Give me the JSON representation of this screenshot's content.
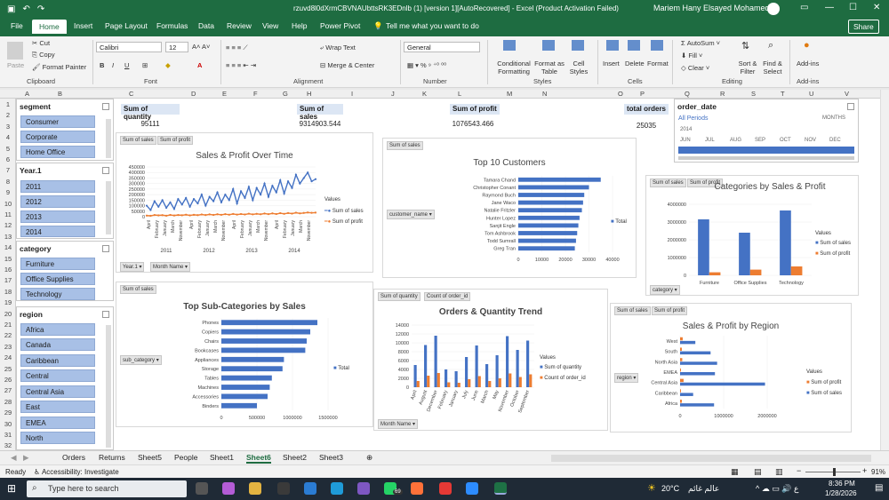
{
  "window": {
    "title": "rzuvd8l0dXrmCBVNAUbttsRK3EDnlb (1) [version 1][AutoRecovered] - Excel (Product Activation Failed)",
    "user": "Mariem Hany Elsayed Mohamed"
  },
  "menu": {
    "tabs": [
      "File",
      "Home",
      "Insert",
      "Page Layout",
      "Formulas",
      "Data",
      "Review",
      "View",
      "Help",
      "Power Pivot"
    ],
    "tell": "Tell me what you want to do",
    "share": "Share"
  },
  "ribbon": {
    "clipboard": {
      "paste": "Paste",
      "cut": "Cut",
      "copy": "Copy",
      "painter": "Format Painter",
      "group": "Clipboard"
    },
    "font": {
      "name": "Calibri",
      "size": "12",
      "group": "Font"
    },
    "alignment": {
      "wrap": "Wrap Text",
      "merge": "Merge & Center",
      "group": "Alignment"
    },
    "number": {
      "format": "General",
      "group": "Number"
    },
    "styles": {
      "cond": "Conditional Formatting",
      "table": "Format as Table",
      "cell": "Cell Styles",
      "group": "Styles"
    },
    "cells": {
      "insert": "Insert",
      "delete": "Delete",
      "format": "Format",
      "group": "Cells"
    },
    "editing": {
      "autosum": "AutoSum",
      "fill": "Fill",
      "clear": "Clear",
      "sort": "Sort & Filter",
      "find": "Find & Select",
      "group": "Editing"
    },
    "addins": {
      "label": "Add-ins",
      "group": "Add-ins"
    }
  },
  "columns": [
    "A",
    "B",
    "C",
    "D",
    "E",
    "F",
    "G",
    "H",
    "I",
    "J",
    "K",
    "L",
    "M",
    "N",
    "O",
    "P",
    "Q",
    "R",
    "S",
    "T",
    "U",
    "V",
    "W"
  ],
  "rows": [
    "1",
    "2",
    "3",
    "4",
    "5",
    "6",
    "7",
    "8",
    "9",
    "10",
    "11",
    "12",
    "13",
    "14",
    "15",
    "16",
    "17",
    "18",
    "19",
    "20",
    "21",
    "22",
    "23",
    "24",
    "25",
    "26",
    "27",
    "28",
    "29",
    "30",
    "31",
    "32"
  ],
  "slicers": {
    "segment": {
      "title": "segment",
      "items": [
        "Consumer",
        "Corporate",
        "Home Office"
      ]
    },
    "year": {
      "title": "Year.1",
      "items": [
        "2011",
        "2012",
        "2013",
        "2014"
      ]
    },
    "category": {
      "title": "category",
      "items": [
        "Furniture",
        "Office Supplies",
        "Technology"
      ]
    },
    "region": {
      "title": "region",
      "items": [
        "Africa",
        "Canada",
        "Caribbean",
        "Central",
        "Central Asia",
        "East",
        "EMEA",
        "North"
      ]
    },
    "order_date": {
      "title": "order_date",
      "period": "All Periods",
      "unit": "MONTHS",
      "year": "2014",
      "months": [
        "JUN",
        "JUL",
        "AUG",
        "SEP",
        "OCT",
        "NOV",
        "DEC"
      ]
    }
  },
  "kpis": [
    {
      "label": "Sum of quantity",
      "value": "95111"
    },
    {
      "label": "Sum of sales",
      "value": "9314903.544"
    },
    {
      "label": "Sum of profit",
      "value": "1076543.466"
    },
    {
      "label": "total orders",
      "value": "25035"
    }
  ],
  "chart_data": [
    {
      "type": "line",
      "title": "Sales & Profit Over Time",
      "yticks": [
        "450000",
        "400000",
        "350000",
        "300000",
        "250000",
        "200000",
        "150000",
        "100000",
        "50000",
        "0"
      ],
      "years": [
        "2011",
        "2012",
        "2013",
        "2014"
      ],
      "months": [
        "April",
        "February",
        "January",
        "March",
        "November"
      ],
      "series": [
        {
          "name": "Sum of sales",
          "color": "#4472c4",
          "values": [
            100000,
            60000,
            140000,
            90000,
            150000,
            80000,
            130000,
            70000,
            160000,
            110000,
            170000,
            90000,
            160000,
            120000,
            200000,
            100000,
            180000,
            140000,
            220000,
            130000,
            200000,
            150000,
            250000,
            120000,
            230000,
            170000,
            270000,
            150000,
            260000,
            200000,
            300000,
            180000,
            280000,
            220000,
            330000,
            210000,
            320000,
            260000,
            380000,
            300000,
            350000,
            400000,
            320000,
            340000
          ]
        },
        {
          "name": "Sum of profit",
          "color": "#ed7d31",
          "values": [
            10000,
            8000,
            15000,
            12000,
            14000,
            9000,
            16000,
            11000,
            15000,
            13000,
            18000,
            12000,
            17000,
            14000,
            20000,
            15000,
            21000,
            16000,
            22000,
            17000,
            23000,
            18000,
            25000,
            19000,
            24000,
            20000,
            27000,
            21000,
            26000,
            22000,
            29000,
            23000,
            30000,
            24000,
            32000,
            26000,
            33000,
            28000,
            36000,
            30000,
            34000,
            38000,
            35000,
            37000
          ]
        }
      ],
      "legend_title": "Values",
      "buttons": [
        "Sum of sales",
        "Sum of profit",
        "Year.1",
        "Month Name"
      ]
    },
    {
      "type": "bar",
      "title": "Top 10 Customers",
      "categories": [
        "Tamara Chand",
        "Christopher Conant",
        "Raymond Buch",
        "Jane Waco",
        "Natalie Fritzler",
        "Hunter Lopez",
        "Sanjit Engle",
        "Tom Ashbrook",
        "Todd Sumrall",
        "Greg Tran"
      ],
      "values": [
        35000,
        30000,
        28000,
        27500,
        27000,
        26000,
        25500,
        25000,
        24500,
        24000
      ],
      "xticks": [
        "0",
        "10000",
        "20000",
        "30000",
        "40000"
      ],
      "xlim": [
        0,
        40000
      ],
      "legend": "Total",
      "buttons": [
        "Sum of sales",
        "customer_name"
      ]
    },
    {
      "type": "bar",
      "title": "Categories by Sales & Profit",
      "categories": [
        "Furniture",
        "Office Supplies",
        "Technology"
      ],
      "yticks": [
        "4000000",
        "3000000",
        "2000000",
        "1000000",
        "0"
      ],
      "ylim": [
        0,
        4000000
      ],
      "series": [
        {
          "name": "Sum of sales",
          "color": "#4472c4",
          "values": [
            3150000,
            2400000,
            3650000
          ]
        },
        {
          "name": "Sum of profit",
          "color": "#ed7d31",
          "values": [
            170000,
            320000,
            500000
          ]
        }
      ],
      "legend_title": "Values",
      "buttons": [
        "Sum of sales",
        "Sum of profit",
        "category"
      ]
    },
    {
      "type": "bar",
      "title": "Top Sub-Categories by Sales",
      "categories": [
        "Phones",
        "Copiers",
        "Chairs",
        "Bookcases",
        "Appliances",
        "Storage",
        "Tables",
        "Machines",
        "Accessories",
        "Binders"
      ],
      "values": [
        1350000,
        1250000,
        1200000,
        1180000,
        880000,
        860000,
        710000,
        680000,
        650000,
        500000
      ],
      "xticks": [
        "0",
        "500000",
        "1000000",
        "1500000"
      ],
      "xlim": [
        0,
        1500000
      ],
      "legend": "Total",
      "buttons": [
        "Sum of sales",
        "sub_category"
      ]
    },
    {
      "type": "bar",
      "title": "Orders & Quantity Trend",
      "categories": [
        "April",
        "August",
        "December",
        "February",
        "January",
        "July",
        "June",
        "March",
        "May",
        "November",
        "October",
        "September"
      ],
      "yticks": [
        "14000",
        "12000",
        "10000",
        "8000",
        "6000",
        "4000",
        "2000",
        "0"
      ],
      "ylim": [
        0,
        14000
      ],
      "series": [
        {
          "name": "Sum of quantity",
          "color": "#4472c4",
          "values": [
            5000,
            9500,
            11600,
            4000,
            3600,
            6800,
            9400,
            5200,
            7200,
            11500,
            8400,
            10500
          ]
        },
        {
          "name": "Count of order_id",
          "color": "#ed7d31",
          "values": [
            1400,
            2600,
            3200,
            1100,
            1000,
            1800,
            2500,
            1400,
            2000,
            3100,
            2300,
            2900
          ]
        }
      ],
      "legend_title": "Values",
      "buttons": [
        "Sum of quantity",
        "Count of order_id",
        "Month Name"
      ]
    },
    {
      "type": "bar",
      "title": "Sales & Profit by Region",
      "categories": [
        "West",
        "South",
        "North Asia",
        "EMEA",
        "Central Asia",
        "Caribbean",
        "Africa"
      ],
      "xticks": [
        "0",
        "1000000",
        "2000000"
      ],
      "xlim": [
        0,
        2000000
      ],
      "series": [
        {
          "name": "Sum of profit",
          "color": "#ed7d31",
          "values": [
            60000,
            40000,
            50000,
            20000,
            80000,
            20000,
            40000
          ]
        },
        {
          "name": "Sum of sales",
          "color": "#4472c4",
          "values": [
            350000,
            700000,
            850000,
            800000,
            1950000,
            300000,
            780000
          ]
        }
      ],
      "legend_title": "Values",
      "buttons": [
        "Sum of sales",
        "Sum of profit",
        "region"
      ]
    }
  ],
  "sheets": {
    "tabs": [
      "Orders",
      "Returns",
      "Sheet5",
      "People",
      "Sheet1",
      "Sheet6",
      "Sheet2",
      "Sheet3"
    ],
    "active": "Sheet6"
  },
  "status": {
    "ready": "Ready",
    "access": "Accessibility: Investigate",
    "zoom": "91%"
  },
  "taskbar": {
    "search": "Type here to search",
    "temp": "20°C",
    "weather": "عالم غائم",
    "time": "8:36 PM",
    "date": "1/28/2026",
    "badge": "69"
  }
}
